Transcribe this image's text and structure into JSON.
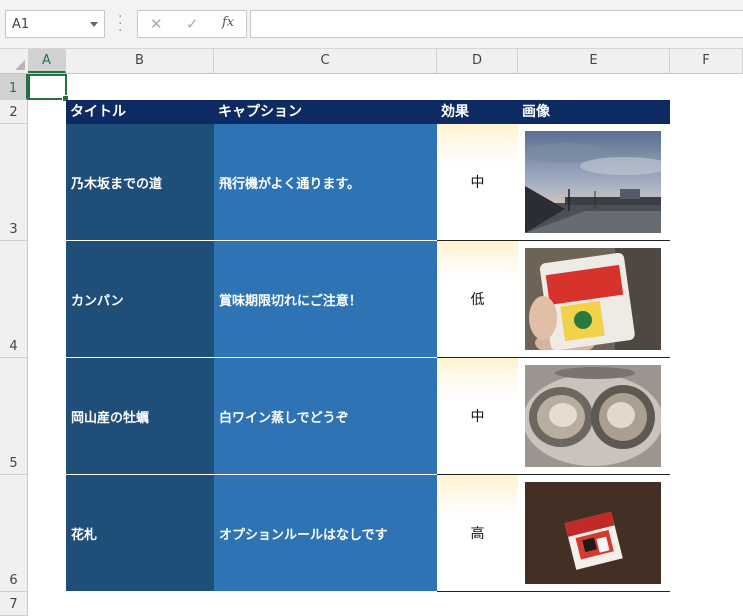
{
  "formula_bar": {
    "name_box": "A1",
    "cancel_icon": "✕",
    "enter_icon": "✓",
    "fx_label": "fx",
    "formula": ""
  },
  "columns": [
    "A",
    "B",
    "C",
    "D",
    "E",
    "F"
  ],
  "rows": [
    "1",
    "2",
    "3",
    "4",
    "5",
    "6",
    "7"
  ],
  "table": {
    "headers": [
      "タイトル",
      "キャプション",
      "効果",
      "画像"
    ],
    "rows": [
      {
        "title": "乃木坂までの道",
        "caption": "飛行機がよく通ります。",
        "effect": "中",
        "image": "photo of a road and sky at dusk"
      },
      {
        "title": "カンパン",
        "caption": "賞味期限切れにご注意！",
        "effect": "低",
        "image": "photo of a kanpan can held in hand"
      },
      {
        "title": "岡山産の牡蠣",
        "caption": "白ワイン蒸しでどうぞ",
        "effect": "中",
        "image": "photo of steamed oysters on a plate"
      },
      {
        "title": "花札",
        "caption": "オプションルールはなしです",
        "effect": "高",
        "image": "photo of a hanafuda card box"
      }
    ]
  },
  "colors": {
    "header_bg": "#0e2a62",
    "title_bg": "#1f4e79",
    "caption_bg": "#2e74b5",
    "effect_highlight": "#fff2cc",
    "selection": "#217346"
  }
}
